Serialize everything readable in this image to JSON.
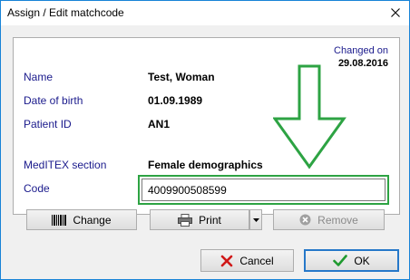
{
  "window": {
    "title": "Assign / Edit matchcode"
  },
  "changed": {
    "label": "Changed on",
    "date": "29.08.2016"
  },
  "fields": {
    "name": {
      "label": "Name",
      "value": "Test, Woman"
    },
    "dob": {
      "label": "Date of birth",
      "value": "01.09.1989"
    },
    "patient_id": {
      "label": "Patient ID",
      "value": "AN1"
    },
    "section": {
      "label": "MedITEX section",
      "value": "Female demographics"
    },
    "code": {
      "label": "Code",
      "value": "4009900508599"
    }
  },
  "buttons": {
    "change": "Change",
    "print": "Print",
    "remove": "Remove",
    "cancel": "Cancel",
    "ok": "OK"
  },
  "icons": {
    "close": "close-icon",
    "barcode": "barcode-icon",
    "printer": "printer-icon",
    "dropdown": "chevron-down-icon",
    "remove": "remove-circle-icon",
    "cancel": "red-x-icon",
    "ok": "green-check-icon",
    "annotation": "down-arrow-icon"
  },
  "colors": {
    "label_text": "#1a1a8c",
    "annotation_green": "#2da343",
    "window_border": "#1883d7"
  }
}
